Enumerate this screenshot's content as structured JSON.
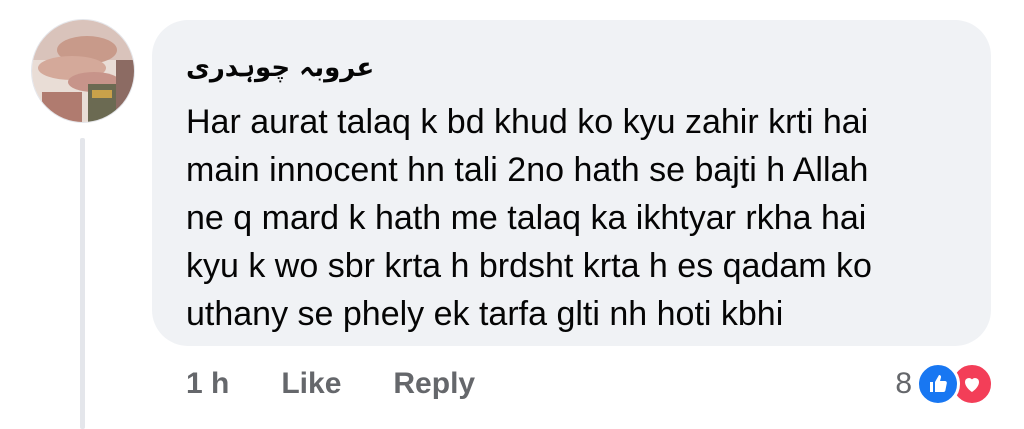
{
  "comment": {
    "author": "عروبہ چوہدری",
    "lines": [
      "Har aurat talaq k bd khud ko kyu zahir krti hai",
      "main innocent hn tali 2no hath se bajti h Allah",
      "ne q mard k hath me talaq ka ikhtyar rkha hai",
      "kyu k wo sbr krta h brdsht krta h es qadam ko",
      "uthany se phely ek tarfa glti nh hoti kbhi"
    ]
  },
  "actions": {
    "time": "1 h",
    "like_label": "Like",
    "reply_label": "Reply"
  },
  "reactions": {
    "count": "8",
    "types": [
      "like-icon",
      "love-icon"
    ],
    "like_color": "#1877f2",
    "love_color": "#f33e58"
  },
  "colors": {
    "bubble": "#f0f2f5",
    "text": "#050505",
    "secondary": "#65676b"
  }
}
